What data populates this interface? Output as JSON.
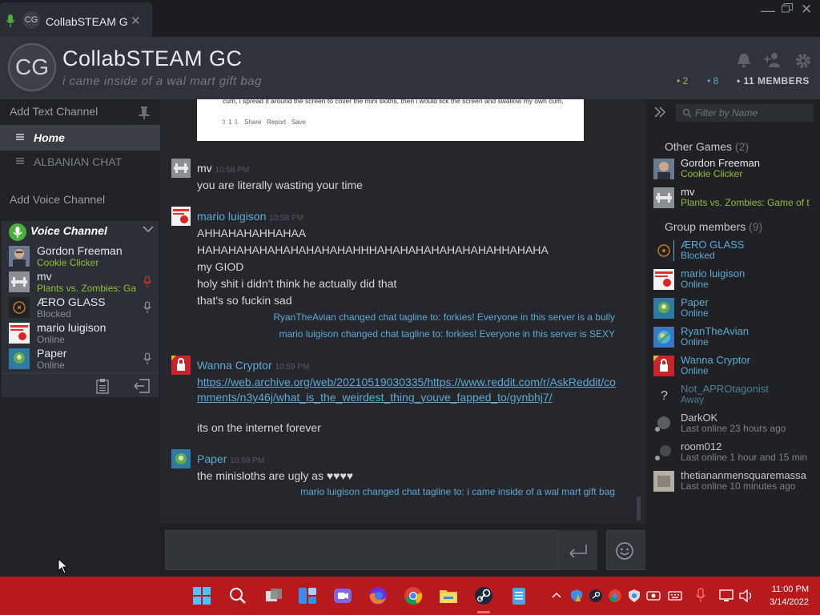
{
  "tab": {
    "avatar": "CG",
    "title": "CollabSTEAM G",
    "close": "✕"
  },
  "window": {
    "minimize": "—",
    "close": "✕"
  },
  "group": {
    "avatar": "CG",
    "title": "CollabSTEAM GC",
    "tagline": "i came inside of a wal mart gift bag",
    "stats": {
      "ingame": "• 2",
      "online": "• 8",
      "members": "• 11 MEMBERS"
    }
  },
  "sidebar": {
    "add_text": "Add Text Channel",
    "channels": [
      {
        "label": "Home",
        "active": true
      },
      {
        "label": "ALBANIAN CHAT",
        "active": false
      }
    ],
    "add_voice": "Add Voice Channel",
    "voice_channel": {
      "label": "Voice Channel",
      "users": [
        {
          "name": "Gordon Freeman",
          "status": "Cookie Clicker",
          "status_color": "#8fbf3c"
        },
        {
          "name": "mv",
          "status": "Plants vs. Zombies: Ga",
          "status_color": "#8fbf3c"
        },
        {
          "name": "ÆRO GLASS",
          "status": "Blocked",
          "status_color": "#8b8f95"
        },
        {
          "name": "mario luigison",
          "status": "Online",
          "status_color": "#8b8f95"
        },
        {
          "name": "Paper",
          "status": "Online",
          "status_color": "#8b8f95"
        }
      ]
    }
  },
  "chat": {
    "embed": {
      "text": "cum, i spread it around the screen to cover the mini sloths, then i would lick the screen and swallow my own cum.",
      "votes": "1",
      "share": "Share",
      "report": "Report",
      "save": "Save"
    },
    "messages": [
      {
        "author": "mv",
        "time": "10:58 PM",
        "lines": [
          "you are literally wasting your time"
        ]
      },
      {
        "author": "mario luigison",
        "time": "10:58 PM",
        "lines": [
          "AHHAHAHAHHAHAA",
          "HAHAHAHAHAHAHAHAHAHAHHHAHAHAHAHAHAHAHAHHAHAHA",
          "my GIOD",
          "holy shit i didn't think he actually did that",
          "that's so fuckin sad"
        ]
      },
      {
        "author": "Wanna Cryptor",
        "time": "10:59 PM",
        "link": "https://web.archive.org/web/20210519030335/https://www.reddit.com/r/AskReddit/comments/n3y46j/what_is_the_weirdest_thing_youve_fapped_to/gynbhj7/",
        "lines": [
          "its on the internet forever"
        ]
      },
      {
        "author": "Paper",
        "time": "10:59 PM",
        "lines": [
          "the minisloths are ugly as ♥♥♥♥"
        ]
      }
    ],
    "system": [
      "RyanTheAvian changed chat tagline to: forkies! Everyone in this server is a bully",
      "mario luigison changed chat tagline to: forkies! Everyone in this server is SEXY",
      "mario luigison changed chat tagline to: i came inside of a wal mart gift bag"
    ]
  },
  "members": {
    "filter_placeholder": "Filter by Name",
    "other_games": {
      "title": "Other Games",
      "count": "(2)"
    },
    "games": [
      {
        "name": "Gordon Freeman",
        "status": "Cookie Clicker"
      },
      {
        "name": "mv",
        "status": "Plants vs. Zombies: Game of t"
      }
    ],
    "group_members": {
      "title": "Group members",
      "count": "(9)"
    },
    "list": [
      {
        "name": "ÆRO GLASS",
        "status": "Blocked",
        "name_color": "#5fa8d3",
        "status_color": "#5fa8d3"
      },
      {
        "name": "mario luigison",
        "status": "Online",
        "name_color": "#5fa8d3",
        "status_color": "#5fa8d3"
      },
      {
        "name": "Paper",
        "status": "Online",
        "name_color": "#5fa8d3",
        "status_color": "#5fa8d3"
      },
      {
        "name": "RyanTheAvian",
        "status": "Online",
        "name_color": "#5fa8d3",
        "status_color": "#5fa8d3"
      },
      {
        "name": "Wanna Cryptor",
        "status": "Online",
        "name_color": "#5fa8d3",
        "status_color": "#5fa8d3"
      },
      {
        "name": "Not_APROtagonist",
        "status": "Away",
        "name_color": "#4f7d96",
        "status_color": "#4f7d96"
      },
      {
        "name": "DarkOK",
        "status": "Last online 23 hours ago",
        "name_color": "#c6c8cc",
        "status_color": "#7d8187"
      },
      {
        "name": "room012",
        "status": "Last online 1 hour and 15 min",
        "name_color": "#c6c8cc",
        "status_color": "#7d8187"
      },
      {
        "name": "thetiananmensquaremassa",
        "status": "Last online 10 minutes ago",
        "name_color": "#c6c8cc",
        "status_color": "#7d8187"
      }
    ]
  },
  "taskbar": {
    "time": "11:00 PM",
    "date": "3/14/2022"
  },
  "colors": {
    "ingame": "#8fbf3c",
    "online": "#5fa8d3",
    "taskbar": "#b8191d",
    "voice_green": "#3aa02e"
  }
}
